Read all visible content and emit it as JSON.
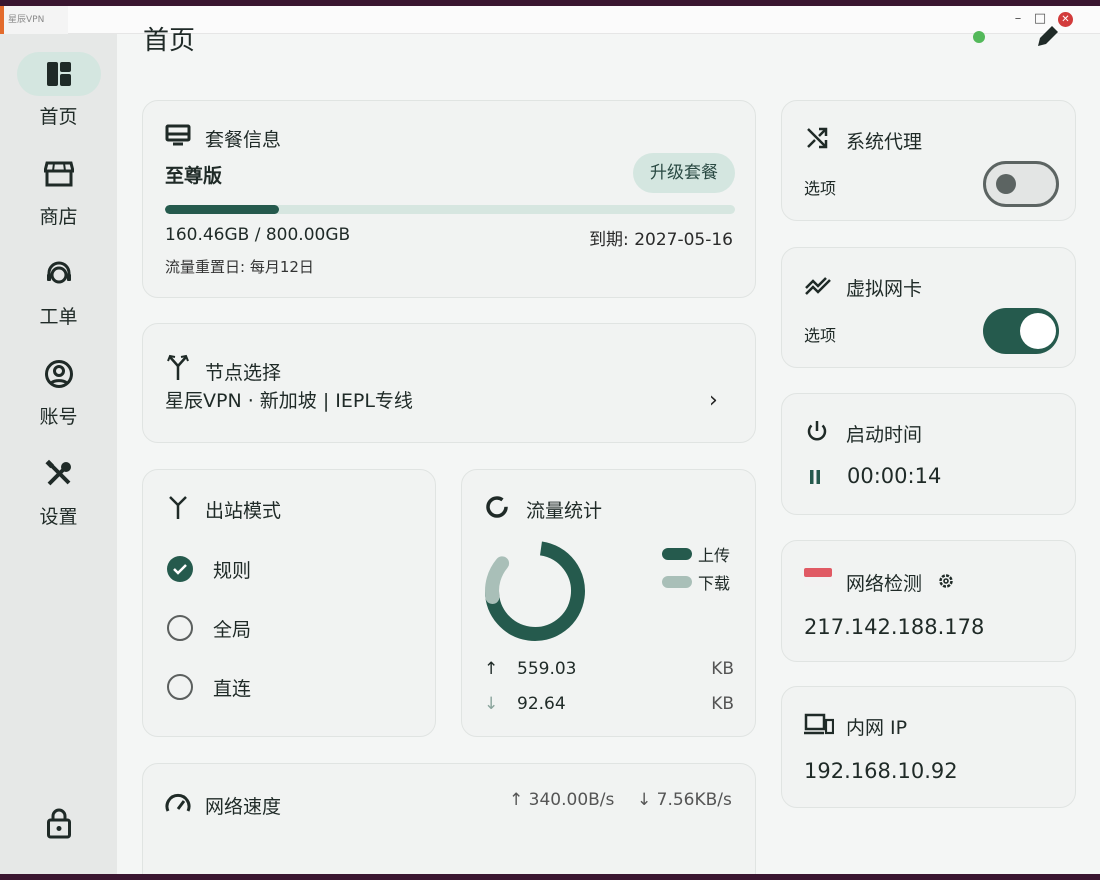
{
  "titlebar": {
    "app_tag": "星辰VPN",
    "min": "–",
    "max": "□",
    "close": "✕"
  },
  "sidebar": {
    "items": [
      {
        "label": "首页",
        "icon": "dashboard-icon"
      },
      {
        "label": "商店",
        "icon": "store-icon"
      },
      {
        "label": "工单",
        "icon": "support-agent-icon"
      },
      {
        "label": "账号",
        "icon": "account-circle-icon"
      },
      {
        "label": "设置",
        "icon": "tools-icon"
      }
    ],
    "lock_icon": "lock-icon"
  },
  "header": {
    "title": "首页",
    "status_color": "#53b95a"
  },
  "plan": {
    "title": "套餐信息",
    "name": "至尊版",
    "upgrade_label": "升级套餐",
    "used_fraction": 0.2006,
    "usage": "160.46GB / 800.00GB",
    "expire": "到期: 2027-05-16",
    "reset": "流量重置日: 每月12日"
  },
  "node": {
    "title": "节点选择",
    "name": "星辰VPN · 新加坡 | IEPL专线"
  },
  "mode": {
    "title": "出站模式",
    "options": [
      {
        "label": "规则",
        "checked": true
      },
      {
        "label": "全局",
        "checked": false
      },
      {
        "label": "直连",
        "checked": false
      }
    ]
  },
  "traffic": {
    "title": "流量统计",
    "legend_up": "上传",
    "legend_down": "下载",
    "up_value": "559.03",
    "up_unit": "KB",
    "down_value": "92.64",
    "down_unit": "KB",
    "up_arrow": "↑",
    "down_arrow": "↓"
  },
  "speed": {
    "title": "网络速度",
    "up": "↑ 340.00B/s",
    "down": "↓ 7.56KB/s"
  },
  "proxy": {
    "title": "系统代理",
    "option": "选项",
    "enabled": false
  },
  "tun": {
    "title": "虚拟网卡",
    "option": "选项",
    "enabled": true
  },
  "uptime": {
    "title": "启动时间",
    "value": "00:00:14"
  },
  "netcheck": {
    "title": "网络检测",
    "ip": "217.142.188.178"
  },
  "lan": {
    "title": "内网 IP",
    "ip": "192.168.10.92"
  },
  "colors": {
    "accent": "#255a4d",
    "accent_light": "#d4e6e0",
    "download": "#a9bfb8"
  }
}
